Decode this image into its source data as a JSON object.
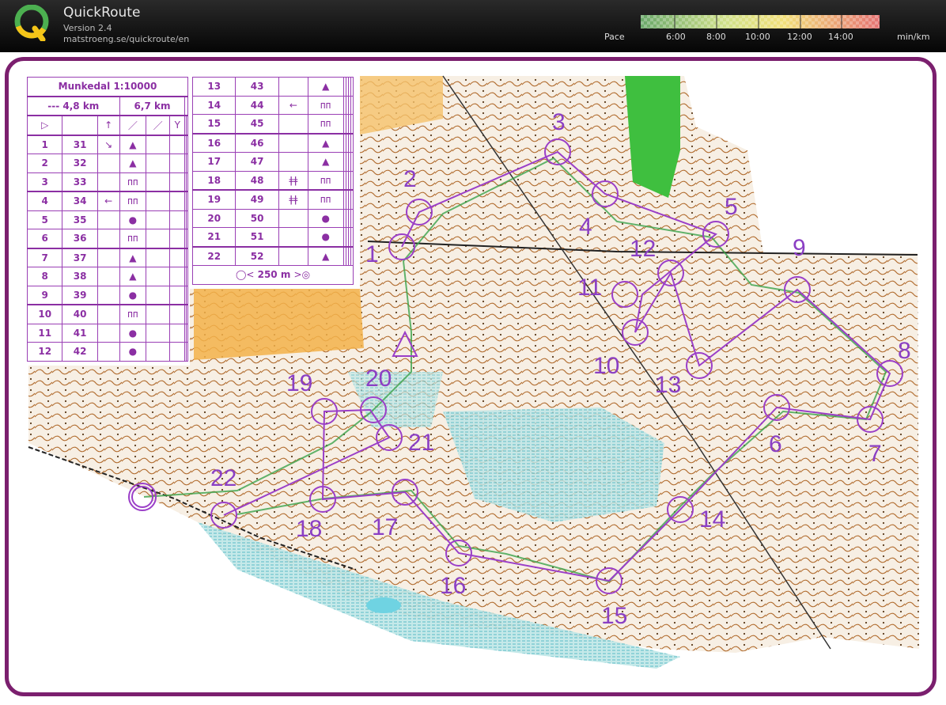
{
  "app": {
    "title": "QuickRoute",
    "version": "Version 2.4",
    "url": "matstroeng.se/quickroute/en"
  },
  "pace": {
    "label": "Pace",
    "ticks": [
      "6:00",
      "8:00",
      "10:00",
      "12:00",
      "14:00"
    ],
    "unit": "min/km"
  },
  "event": {
    "title": "Munkedal 1:10000",
    "course_length_a": "--- 4,8 km",
    "course_length_b": "6,7 km",
    "finish_distance": "250 m"
  },
  "controls_left": [
    {
      "num": "1",
      "code": "31",
      "dir": "↘",
      "sym": "▲"
    },
    {
      "num": "2",
      "code": "32",
      "dir": "",
      "sym": "▲"
    },
    {
      "num": "3",
      "code": "33",
      "dir": "",
      "sym": "ᴨᴨ"
    },
    {
      "num": "4",
      "code": "34",
      "dir": "←",
      "sym": "ᴨᴨ"
    },
    {
      "num": "5",
      "code": "35",
      "dir": "",
      "sym": "●"
    },
    {
      "num": "6",
      "code": "36",
      "dir": "",
      "sym": "ᴨᴨ"
    },
    {
      "num": "7",
      "code": "37",
      "dir": "",
      "sym": "▲"
    },
    {
      "num": "8",
      "code": "38",
      "dir": "",
      "sym": "▲"
    },
    {
      "num": "9",
      "code": "39",
      "dir": "",
      "sym": "●"
    },
    {
      "num": "10",
      "code": "40",
      "dir": "",
      "sym": "ᴨᴨ"
    },
    {
      "num": "11",
      "code": "41",
      "dir": "",
      "sym": "●"
    },
    {
      "num": "12",
      "code": "42",
      "dir": "",
      "sym": "●"
    }
  ],
  "controls_right": [
    {
      "num": "13",
      "code": "43",
      "dir": "",
      "sym2": "",
      "sym": "▲"
    },
    {
      "num": "14",
      "code": "44",
      "dir": "←",
      "sym2": "",
      "sym": "ᴨᴨ"
    },
    {
      "num": "15",
      "code": "45",
      "dir": "",
      "sym2": "",
      "sym": "ᴨᴨ"
    },
    {
      "num": "16",
      "code": "46",
      "dir": "",
      "sym2": "",
      "sym": "▲"
    },
    {
      "num": "17",
      "code": "47",
      "dir": "",
      "sym2": "",
      "sym": "▲"
    },
    {
      "num": "18",
      "code": "48",
      "dir": "ǂǂ",
      "sym2": "",
      "sym": "ᴨᴨ"
    },
    {
      "num": "19",
      "code": "49",
      "dir": "ǂǂ",
      "sym2": "",
      "sym": "ᴨᴨ"
    },
    {
      "num": "20",
      "code": "50",
      "dir": "",
      "sym2": "",
      "sym": "●"
    },
    {
      "num": "21",
      "code": "51",
      "dir": "",
      "sym2": "",
      "sym": "●"
    },
    {
      "num": "22",
      "code": "52",
      "dir": "",
      "sym2": "",
      "sym": "▲"
    }
  ],
  "map_labels": [
    "1",
    "2",
    "3",
    "4",
    "5",
    "6",
    "7",
    "8",
    "9",
    "10",
    "11",
    "12",
    "13",
    "14",
    "15",
    "16",
    "17",
    "18",
    "19",
    "20",
    "21",
    "22"
  ],
  "colors": {
    "frame": "#7b1f6e",
    "course": "#9b3fc8",
    "pace_slow": "#e57373",
    "pace_fast": "#6aa86a"
  }
}
